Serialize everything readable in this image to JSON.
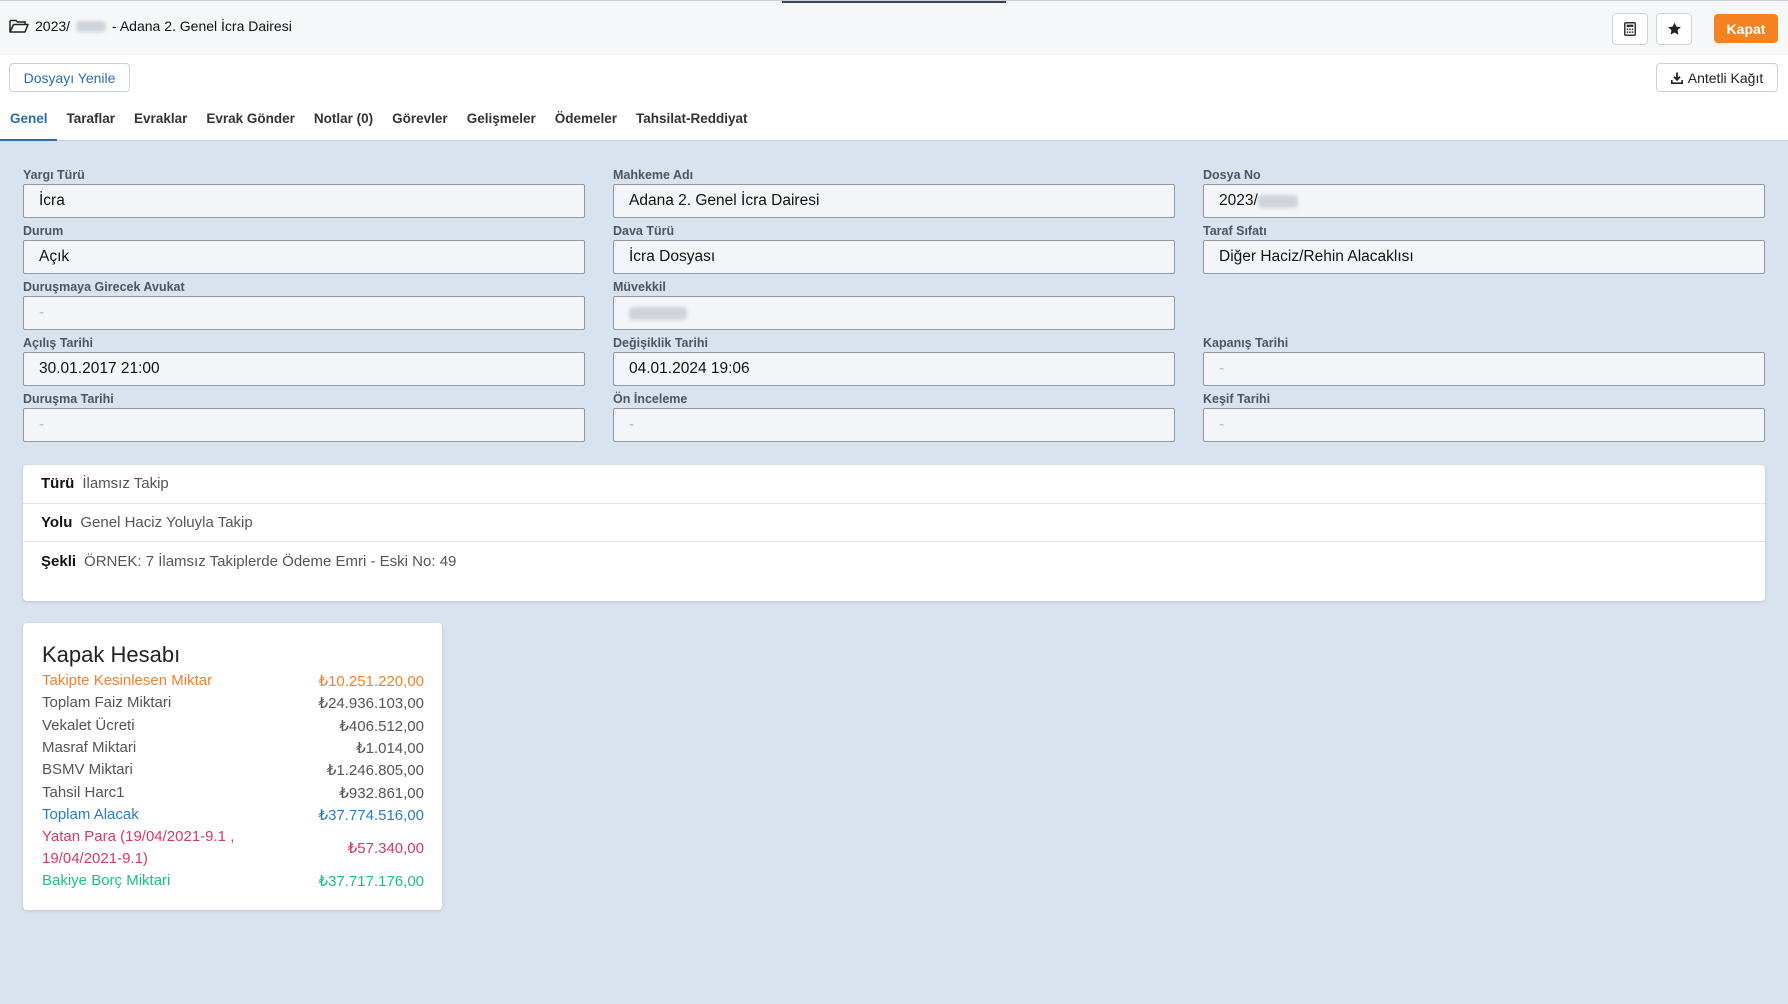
{
  "header": {
    "file_prefix": "2023/",
    "file_suffix": "- Adana 2. Genel İcra Dairesi",
    "close_label": "Kapat",
    "icons": [
      "folder-open-icon",
      "calculator-icon",
      "star-icon"
    ]
  },
  "toolbar": {
    "refresh_label": "Dosyayı Yenile",
    "letterhead_label": "Antetli Kağıt",
    "letterhead_icon": "download-icon"
  },
  "tabs": [
    {
      "label": "Genel",
      "active": true
    },
    {
      "label": "Taraflar"
    },
    {
      "label": "Evraklar"
    },
    {
      "label": "Evrak Gönder"
    },
    {
      "label": "Notlar (0)"
    },
    {
      "label": "Görevler"
    },
    {
      "label": "Gelişmeler"
    },
    {
      "label": "Ödemeler"
    },
    {
      "label": "Tahsilat-Reddiyat"
    }
  ],
  "fields": {
    "yargi_turu": {
      "label": "Yargı Türü",
      "value": "İcra"
    },
    "mahkeme_adi": {
      "label": "Mahkeme Adı",
      "value": "Adana 2. Genel İcra Dairesi"
    },
    "dosya_no": {
      "label": "Dosya No",
      "value": "2023/"
    },
    "durum": {
      "label": "Durum",
      "value": "Açık"
    },
    "dava_turu": {
      "label": "Dava Türü",
      "value": "İcra Dosyası"
    },
    "taraf_sifati": {
      "label": "Taraf Sıfatı",
      "value": "Diğer Haciz/Rehin Alacaklısı"
    },
    "avukat": {
      "label": "Duruşmaya Girecek Avukat",
      "value": "-"
    },
    "muvekkil": {
      "label": "Müvekkil",
      "value": ""
    },
    "acilis_tarihi": {
      "label": "Açılış Tarihi",
      "value": "30.01.2017 21:00"
    },
    "degisiklik_tarihi": {
      "label": "Değişiklik Tarihi",
      "value": "04.01.2024 19:06"
    },
    "kapanis_tarihi": {
      "label": "Kapanış Tarihi",
      "value": "-"
    },
    "durusma_tarihi": {
      "label": "Duruşma Tarihi",
      "value": "-"
    },
    "on_inceleme": {
      "label": "Ön İnceleme",
      "value": "-"
    },
    "kesif_tarihi": {
      "label": "Keşif Tarihi",
      "value": "-"
    }
  },
  "info": {
    "turu": {
      "label": "Türü",
      "value": "İlamsız Takip"
    },
    "yolu": {
      "label": "Yolu",
      "value": "Genel Haciz Yoluyla Takip"
    },
    "sekli": {
      "label": "Şekli",
      "value": "ÖRNEK: 7 İlamsız Takiplerde Ödeme Emri - Eski No: 49"
    }
  },
  "cover": {
    "title": "Kapak Hesabı",
    "rows": [
      {
        "label": "Takipte Kesinlesen Miktar",
        "value": "₺10.251.220,00",
        "color": "#f0802e"
      },
      {
        "label": "Toplam Faiz Miktari",
        "value": "₺24.936.103,00"
      },
      {
        "label": "Vekalet Ücreti",
        "value": "₺406.512,00"
      },
      {
        "label": "Masraf Miktari",
        "value": "₺1.014,00"
      },
      {
        "label": "BSMV Miktari",
        "value": "₺1.246.805,00"
      },
      {
        "label": "Tahsil Harc1",
        "value": "₺932.861,00"
      },
      {
        "label": "Toplam Alacak",
        "value": "₺37.774.516,00",
        "color": "#2b7bc0"
      },
      {
        "label": "Yatan Para (19/04/2021-9.1 , 19/04/2021-9.1)",
        "value": "₺57.340,00",
        "color": "#d63a5e"
      },
      {
        "label": "Bakiye Borç Miktari",
        "value": "₺37.717.176,00",
        "color": "#1cbf7e"
      }
    ]
  }
}
